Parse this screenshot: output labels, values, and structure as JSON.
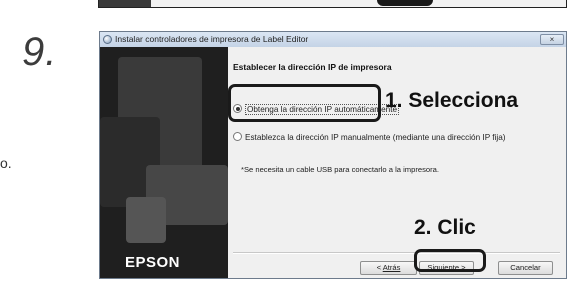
{
  "step_number": "9.",
  "side_fragment": "o.",
  "window": {
    "title": "Instalar controladores de impresora de Label Editor",
    "close_label": "×",
    "heading": "Establecer la dirección IP de impresora",
    "options": [
      {
        "label": "Obtenga la dirección IP automáticamente",
        "selected": true
      },
      {
        "label": "Establezca la dirección IP manualmente (mediante una dirección IP fija)",
        "selected": false
      }
    ],
    "note": "*Se necesita un cable USB para conectarlo a la impresora.",
    "brand_logo": "EPSON",
    "buttons": {
      "back_prefix": "< ",
      "back_label": "Atrás",
      "next_label": "Siguiente",
      "next_suffix": " >",
      "cancel_label": "Cancelar"
    }
  },
  "annotations": {
    "step1": "1. Selecciona",
    "step2": "2. Clic"
  }
}
